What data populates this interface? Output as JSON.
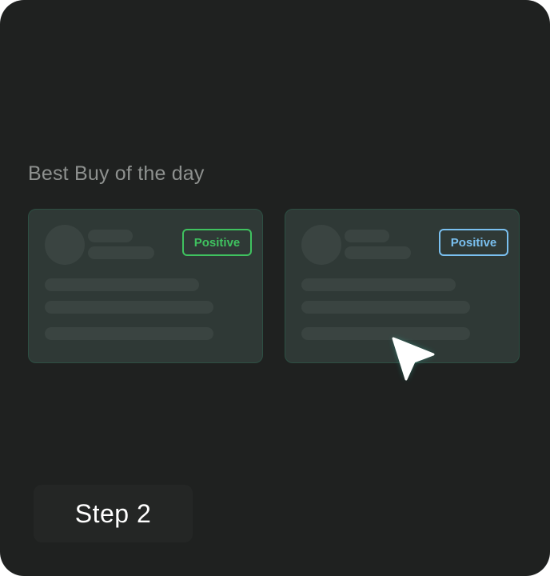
{
  "section": {
    "title": "Best Buy of the day"
  },
  "cards": [
    {
      "badge_label": "Positive",
      "badge_color": "#3fc25f",
      "state": "default"
    },
    {
      "badge_label": "Positive",
      "badge_color": "#7ac0f0",
      "state": "hovered"
    }
  ],
  "cursor": {
    "icon": "pointer-arrow-icon",
    "color": "#ffffff",
    "glow_color": "#2fb8a0"
  },
  "step": {
    "label": "Step 2"
  },
  "colors": {
    "background": "#1f2120",
    "card_background": "#2f3936",
    "card_border": "#2d4f43",
    "placeholder": "#3a4441",
    "title_text": "#8e918f"
  }
}
